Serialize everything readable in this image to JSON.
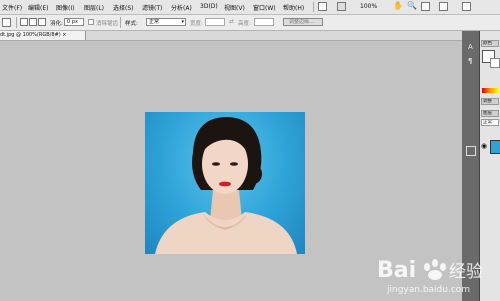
{
  "menu": {
    "items": [
      "文件(F)",
      "编辑(E)",
      "图像(I)",
      "图层(L)",
      "选择(S)",
      "滤镜(T)",
      "分析(A)",
      "3D(D)",
      "视图(V)",
      "窗口(W)",
      "帮助(H)"
    ],
    "zoom": "100%"
  },
  "options": {
    "feather_label": "羽化:",
    "feather_value": "0 px",
    "antialias_label": "消除锯齿",
    "style_label": "样式:",
    "style_value": "正常",
    "width_label": "宽度:",
    "height_label": "高度:",
    "refine_button": "调整边缘..."
  },
  "document": {
    "tab_label": "dt.jpg @ 100%(RGB/8#)",
    "close_glyph": "×"
  },
  "panels": {
    "color_tab": "颜色",
    "adjust_tab": "调整",
    "layers_tab": "图层",
    "blend_mode": "正常"
  },
  "watermark": {
    "brand": "Bai",
    "brand2": "经验",
    "url": "jingyan.baidu.com"
  }
}
